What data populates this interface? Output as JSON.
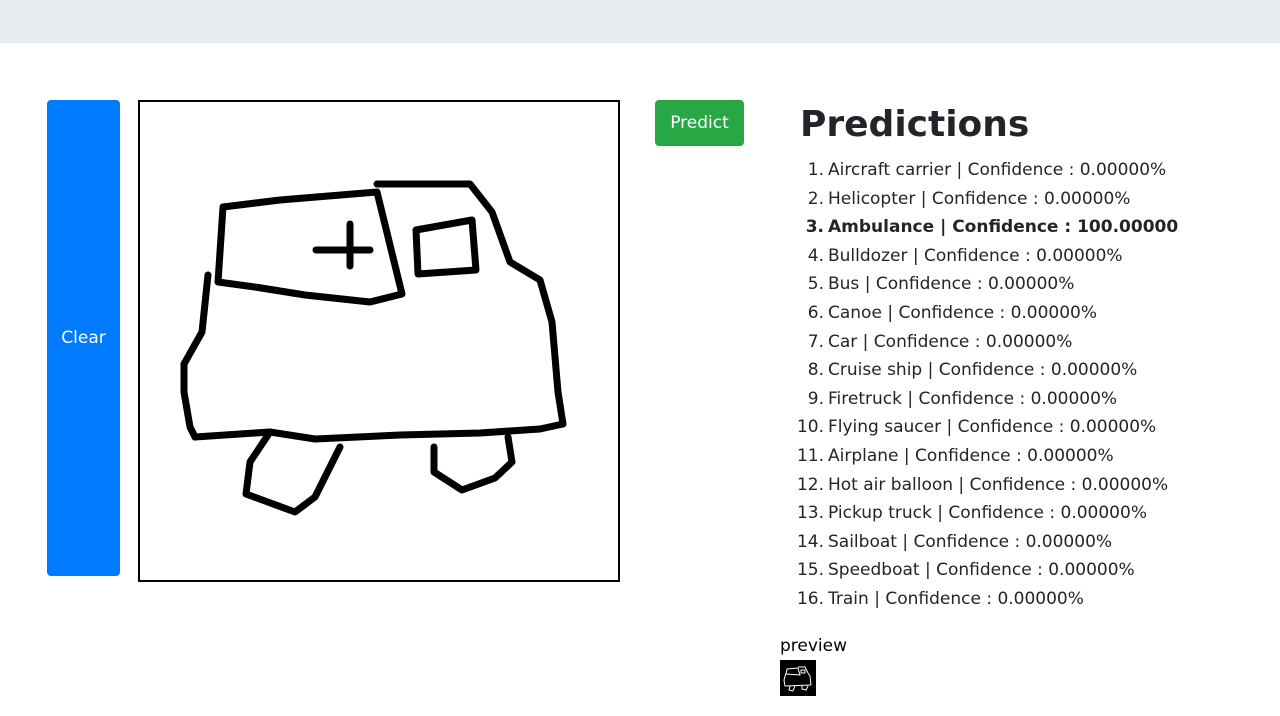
{
  "buttons": {
    "clear_label": "Clear",
    "predict_label": "Predict"
  },
  "predictions": {
    "title": "Predictions",
    "items": [
      {
        "num": "1.",
        "text": "Aircraft carrier | Confidence : 0.00000%"
      },
      {
        "num": "2.",
        "text": "Helicopter | Confidence : 0.00000%"
      },
      {
        "num": "3.",
        "text": "Ambulance | Confidence : 100.00000"
      },
      {
        "num": "4.",
        "text": "Bulldozer | Confidence : 0.00000%"
      },
      {
        "num": "5.",
        "text": "Bus | Confidence : 0.00000%"
      },
      {
        "num": "6.",
        "text": "Canoe | Confidence : 0.00000%"
      },
      {
        "num": "7.",
        "text": "Car | Confidence : 0.00000%"
      },
      {
        "num": "8.",
        "text": "Cruise ship | Confidence : 0.00000%"
      },
      {
        "num": "9.",
        "text": "Firetruck | Confidence : 0.00000%"
      },
      {
        "num": "10.",
        "text": "Flying saucer | Confidence : 0.00000%"
      },
      {
        "num": "11.",
        "text": "Airplane | Confidence : 0.00000%"
      },
      {
        "num": "12.",
        "text": "Hot air balloon | Confidence : 0.00000%"
      },
      {
        "num": "13.",
        "text": "Pickup truck | Confidence : 0.00000%"
      },
      {
        "num": "14.",
        "text": "Sailboat | Confidence : 0.00000%"
      },
      {
        "num": "15.",
        "text": "Speedboat | Confidence : 0.00000%"
      },
      {
        "num": "16.",
        "text": "Train | Confidence : 0.00000%"
      }
    ]
  },
  "preview": {
    "label": "preview"
  },
  "colors": {
    "clear_button": "#007bff",
    "predict_button": "#28a745",
    "topbar": "#e9ecef"
  }
}
